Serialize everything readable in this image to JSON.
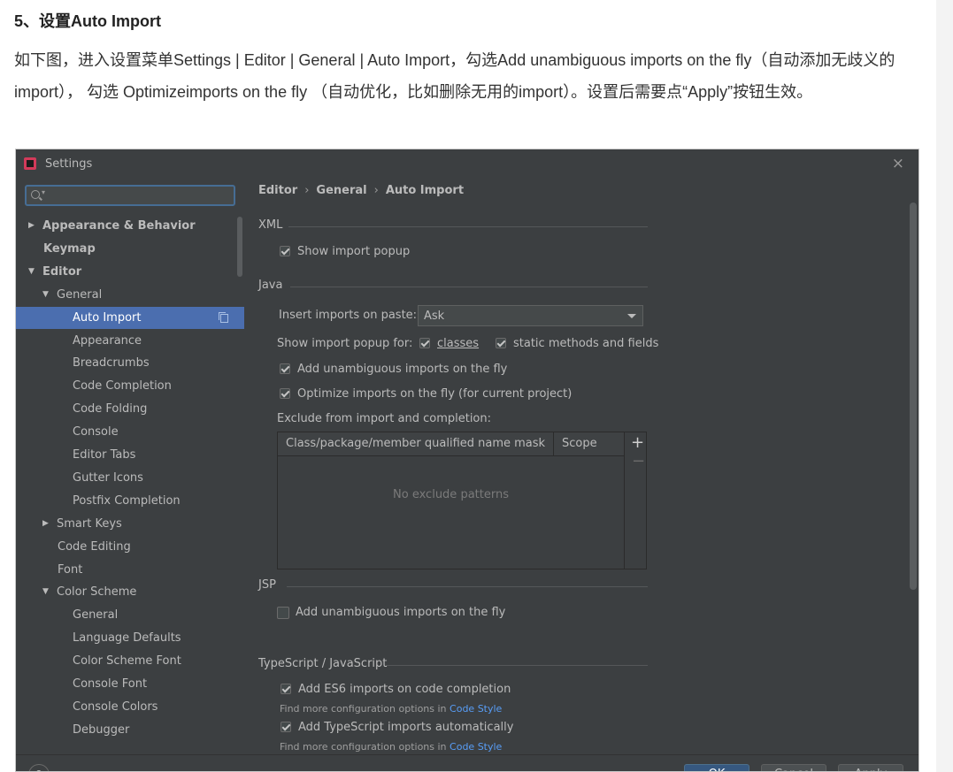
{
  "article": {
    "heading": "5、设置Auto Import",
    "paragraph": "如下图，进入设置菜单Settings | Editor | General | Auto Import，勾选Add unambiguous imports on the fly（自动添加无歧义的import），  勾选 Optimizeimports on the fly （自动优化，比如删除无用的import）。设置后需要点“Apply”按钮生效。"
  },
  "dialog": {
    "title": "Settings",
    "close_glyph": "×",
    "search": {
      "value": "",
      "placeholder": ""
    },
    "breadcrumbs": [
      "Editor",
      "General",
      "Auto Import"
    ],
    "breadcrumb_sep": "›",
    "tree": [
      {
        "label": "Appearance & Behavior",
        "expander": "▶",
        "bold": true,
        "indent": 1
      },
      {
        "label": "Keymap",
        "expander": "",
        "bold": true,
        "indent": 1
      },
      {
        "label": "Editor",
        "expander": "▼",
        "bold": true,
        "indent": 1
      },
      {
        "label": "General",
        "expander": "▼",
        "bold": false,
        "indent": 2
      },
      {
        "label": "Auto Import",
        "expander": "",
        "bold": false,
        "indent": 3,
        "selected": true
      },
      {
        "label": "Appearance",
        "expander": "",
        "bold": false,
        "indent": 3
      },
      {
        "label": "Breadcrumbs",
        "expander": "",
        "bold": false,
        "indent": 3
      },
      {
        "label": "Code Completion",
        "expander": "",
        "bold": false,
        "indent": 3
      },
      {
        "label": "Code Folding",
        "expander": "",
        "bold": false,
        "indent": 3
      },
      {
        "label": "Console",
        "expander": "",
        "bold": false,
        "indent": 3
      },
      {
        "label": "Editor Tabs",
        "expander": "",
        "bold": false,
        "indent": 3
      },
      {
        "label": "Gutter Icons",
        "expander": "",
        "bold": false,
        "indent": 3
      },
      {
        "label": "Postfix Completion",
        "expander": "",
        "bold": false,
        "indent": 3
      },
      {
        "label": "Smart Keys",
        "expander": "▶",
        "bold": false,
        "indent": 2
      },
      {
        "label": "Code Editing",
        "expander": "",
        "bold": false,
        "indent": 2
      },
      {
        "label": "Font",
        "expander": "",
        "bold": false,
        "indent": 2
      },
      {
        "label": "Color Scheme",
        "expander": "▼",
        "bold": false,
        "indent": 2
      },
      {
        "label": "General",
        "expander": "",
        "bold": false,
        "indent": 3
      },
      {
        "label": "Language Defaults",
        "expander": "",
        "bold": false,
        "indent": 3
      },
      {
        "label": "Color Scheme Font",
        "expander": "",
        "bold": false,
        "indent": 3
      },
      {
        "label": "Console Font",
        "expander": "",
        "bold": false,
        "indent": 3
      },
      {
        "label": "Console Colors",
        "expander": "",
        "bold": false,
        "indent": 3
      },
      {
        "label": "Debugger",
        "expander": "",
        "bold": false,
        "indent": 3
      }
    ],
    "xml": {
      "section": "XML",
      "show_import_popup": {
        "label": "Show import popup",
        "checked": true
      }
    },
    "java": {
      "section": "Java",
      "insert_label": "Insert imports on paste:",
      "insert_value": "Ask",
      "popup_for_label": "Show import popup for:",
      "classes": {
        "label": "classes",
        "checked": true
      },
      "static_methods": {
        "label": "static methods and fields",
        "checked": true
      },
      "add_unambiguous": {
        "label": "Add unambiguous imports on the fly",
        "checked": true
      },
      "optimize": {
        "label": "Optimize imports on the fly (for current project)",
        "checked": true
      },
      "exclude_label": "Exclude from import and completion:",
      "table": {
        "col1": "Class/package/member qualified name mask",
        "col2": "Scope",
        "empty": "No exclude patterns",
        "add": "+",
        "remove": "−"
      }
    },
    "jsp": {
      "section": "JSP",
      "add_unambiguous": {
        "label": "Add unambiguous imports on the fly",
        "checked": false
      }
    },
    "ts": {
      "section": "TypeScript / JavaScript",
      "es6": {
        "label": "Add ES6 imports on code completion",
        "checked": true
      },
      "es6_hint": "Find more configuration options in ",
      "es6_link": "Code Style",
      "ts_auto": {
        "label": "Add TypeScript imports automatically",
        "checked": true
      },
      "ts_hint": "Find more configuration options in ",
      "ts_link": "Code Style"
    },
    "footer": {
      "help": "?",
      "ok": "OK",
      "cancel": "Cancel",
      "apply": "Apply"
    }
  }
}
